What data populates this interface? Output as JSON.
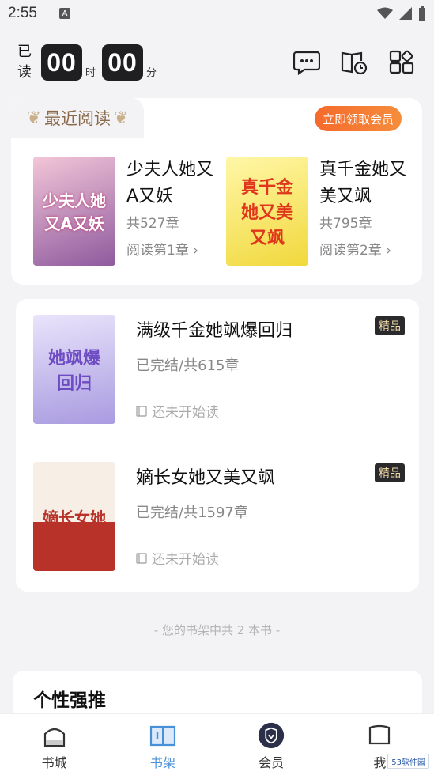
{
  "status_bar": {
    "time": "2:55",
    "a_glyph": "A"
  },
  "header": {
    "read_chars": [
      "已",
      "读"
    ],
    "hours": "00",
    "hours_unit": "时",
    "minutes": "00",
    "minutes_unit": "分",
    "icons": [
      "chat-bubble-icon",
      "reading-history-icon",
      "category-grid-icon"
    ]
  },
  "recent": {
    "tab_label": "最近阅读",
    "vip_button": "立即领取会员",
    "books": [
      {
        "title": "少夫人她又A又妖",
        "chapters": "共527章",
        "progress": "阅读第1章",
        "cover_text": "少夫人她又A又妖",
        "cover_color": "#d96a9a"
      },
      {
        "title": "真千金她又美又飒",
        "chapters": "共795章",
        "progress": "阅读第2章",
        "cover_text": "真千金她又美又飒",
        "cover_color": "#f5e04a"
      }
    ]
  },
  "shelf": {
    "books": [
      {
        "title": "满级千金她飒爆回归",
        "badge": "精品",
        "meta": "已完结/共615章",
        "status": "还未开始读",
        "cover_text": "她飒爆回归",
        "cover_color": "#b9a9e8"
      },
      {
        "title": "嫡长女她又美又飒",
        "badge": "精品",
        "meta": "已完结/共1597章",
        "status": "还未开始读",
        "cover_text": "嫡长女她",
        "cover_color": "#c0392b"
      }
    ],
    "count_text": "- 您的书架中共 2 本书 -"
  },
  "recommend": {
    "title": "个性强推"
  },
  "tabbar": {
    "tabs": [
      {
        "label": "书城",
        "icon": "bookstore-icon"
      },
      {
        "label": "书架",
        "icon": "bookshelf-icon",
        "active": true
      },
      {
        "label": "会员",
        "icon": "vip-shield-icon"
      },
      {
        "label": "我",
        "icon": "profile-icon"
      }
    ]
  },
  "watermark": "53软件园"
}
